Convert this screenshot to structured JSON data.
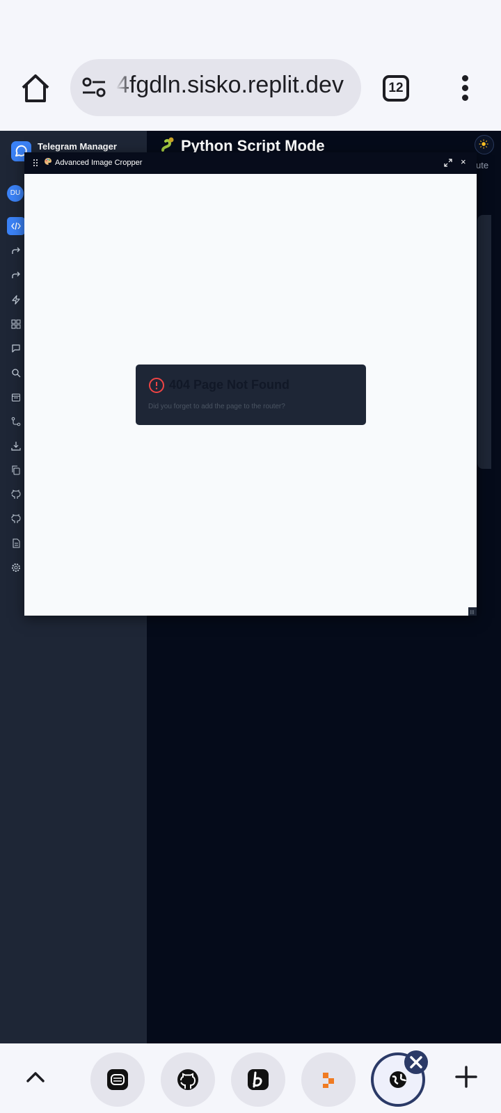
{
  "browser": {
    "url": "4fgdln.sisko.replit.dev",
    "tab_count": "12"
  },
  "sidebar": {
    "brand_title": "Telegram Manager",
    "avatar_initials": "DU",
    "nav_icons": [
      "code-icon",
      "forward-icon",
      "forward-icon",
      "lightning-icon",
      "grid-icon",
      "chat-icon",
      "search-icon",
      "calendar-icon",
      "git-branch-icon",
      "download-icon",
      "copy-icon",
      "github-icon",
      "github-icon",
      "document-icon",
      "gear-icon"
    ]
  },
  "main": {
    "title": "Python Script Mode",
    "side_text": "ute"
  },
  "floating_window": {
    "title": "Advanced Image Cropper",
    "error_title": "404 Page Not Found",
    "error_message": "Did you forget to add the page to the router?"
  },
  "colors": {
    "accent": "#3b82f6",
    "sidebar_bg": "#1e2636",
    "app_bg": "#050b1a",
    "error_red": "#ef4444",
    "browser_active": "#2b3a67"
  },
  "bottom_bar": {
    "quick_access": [
      "shortcut-app-icon",
      "github-icon",
      "b-app-icon",
      "orange-app-icon",
      "globe-icon"
    ]
  }
}
